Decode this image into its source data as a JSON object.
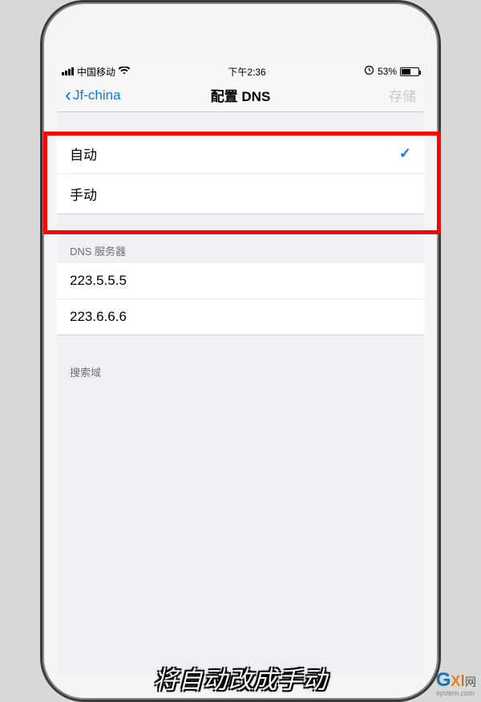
{
  "statusBar": {
    "carrier": "中国移动",
    "time": "下午2:36",
    "batteryText": "53%"
  },
  "navBar": {
    "backLabel": "Jf-china",
    "title": "配置 DNS",
    "saveLabel": "存储"
  },
  "modeGroup": {
    "options": [
      {
        "label": "自动",
        "selected": true
      },
      {
        "label": "手动",
        "selected": false
      }
    ]
  },
  "dnsGroup": {
    "header": "DNS 服务器",
    "servers": [
      "223.5.5.5",
      "223.6.6.6"
    ]
  },
  "searchGroup": {
    "header": "搜索域"
  },
  "caption": "将自动改成手动",
  "watermark": {
    "brand_g": "G",
    "brand_x": "X",
    "brand_i": "I",
    "brand_net": "网",
    "sub": "system.com"
  }
}
